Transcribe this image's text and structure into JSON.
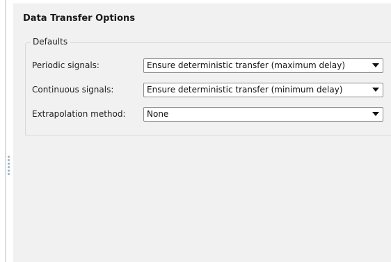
{
  "section_title": "Data Transfer Options",
  "defaults_group": {
    "label": "Defaults",
    "rows": [
      {
        "label": "Periodic signals:",
        "value": "Ensure deterministic transfer (maximum delay)"
      },
      {
        "label": "Continuous signals:",
        "value": "Ensure deterministic transfer (minimum delay)"
      },
      {
        "label": "Extrapolation method:",
        "value": "None"
      }
    ]
  }
}
